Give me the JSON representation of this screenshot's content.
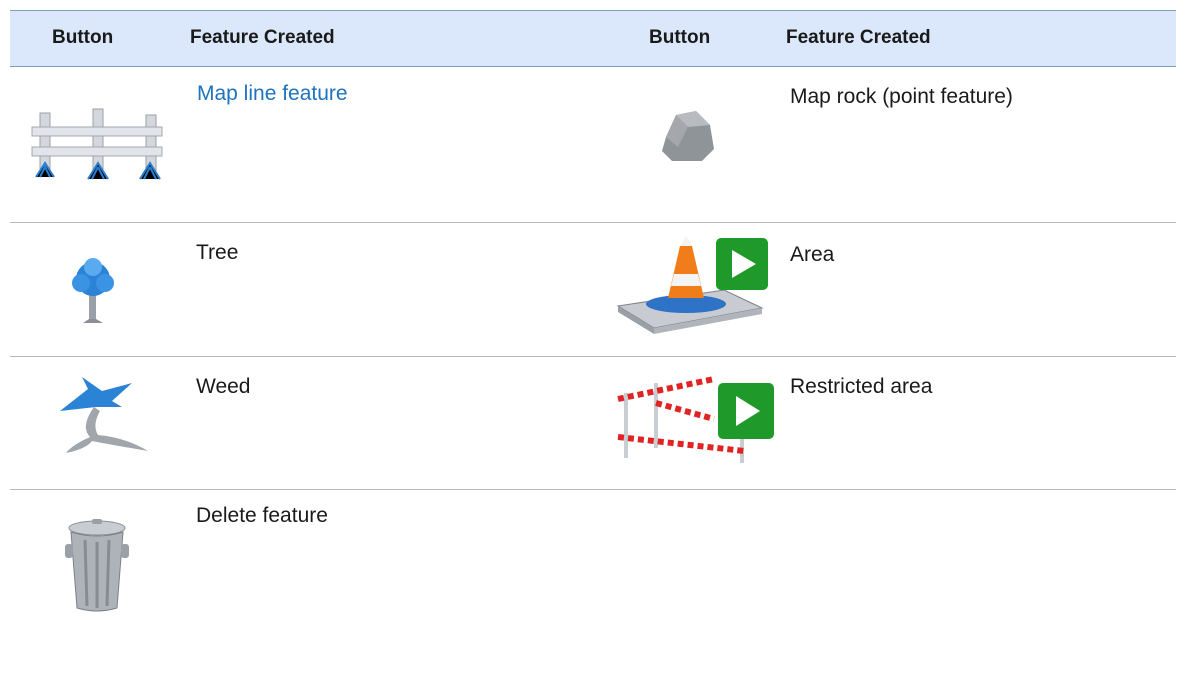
{
  "header": {
    "col1": "Button",
    "col2": "Feature Created",
    "col3": "Button",
    "col4": "Feature Created"
  },
  "rows": [
    {
      "left_icon": "fence-icon",
      "left_label": "Map line feature",
      "right_icon": "rock-icon",
      "right_label": "Map rock (point feature)"
    },
    {
      "left_icon": "tree-icon",
      "left_label": "Tree",
      "right_icon": "area-icon",
      "right_label": "Area"
    },
    {
      "left_icon": "weed-icon",
      "left_label": "Weed",
      "right_icon": "restricted-area-icon",
      "right_label": "Restricted area"
    },
    {
      "left_icon": "trash-can-icon",
      "left_label": "Delete feature",
      "right_icon": "",
      "right_label": ""
    }
  ],
  "colors": {
    "header_bg": "#dbe8fb",
    "link": "#1e73be",
    "play_green": "#1f9a2a",
    "tree_blue": "#2b83d6"
  }
}
